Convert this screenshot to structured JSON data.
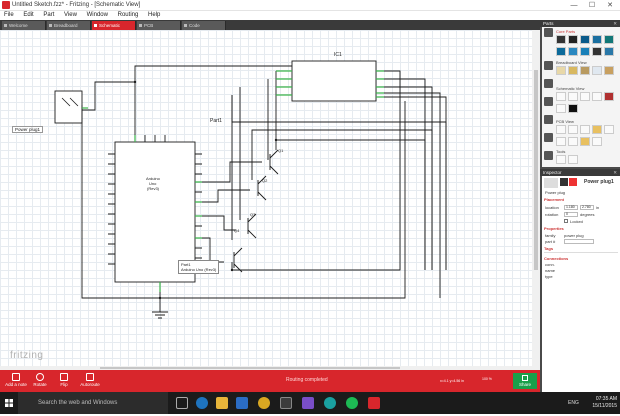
{
  "window": {
    "title": "Untitled Sketch.fzz* - Fritzing - [Schematic View]",
    "min": "—",
    "max": "☐",
    "close": "✕"
  },
  "menu": [
    "File",
    "Edit",
    "Part",
    "View",
    "Window",
    "Routing",
    "Help"
  ],
  "tabs": [
    {
      "label": "Welcome",
      "active": false
    },
    {
      "label": "Breadboard",
      "active": false
    },
    {
      "label": "Schematic",
      "active": true
    },
    {
      "label": "PCB",
      "active": false
    },
    {
      "label": "Code",
      "active": false
    }
  ],
  "canvas": {
    "logo": "fritzing",
    "labels": {
      "ic1": "IC1",
      "part1": "Part1",
      "power_plug": "Power plug1",
      "arduino_name": "Arduino Uno (Rev3)",
      "arduino_line1": "Arduino",
      "arduino_line2": "Uno",
      "arduino_line3": "(Rev3)",
      "q1": "Q1",
      "q2": "Q2",
      "q3": "Q3",
      "q4": "Q4",
      "tooltip_title": "Part1",
      "tooltip_sub": "Arduino Uno (Rev3)"
    }
  },
  "right_panel": {
    "parts_title": "Parts",
    "bins": [
      {
        "label": "Core Parts",
        "icon": "core-icon"
      },
      {
        "label": "Breadboard View",
        "icon": "breadboard-icon"
      },
      {
        "label": "Schematic View",
        "icon": "schematic-icon"
      },
      {
        "label": "PCB View",
        "icon": "pcb-icon"
      },
      {
        "label": "Tools",
        "icon": "tools-icon"
      }
    ],
    "inspector_title": "Inspector",
    "inspector": {
      "name": "Power plug1",
      "subtitle": "Power plug",
      "section_placement": "Placement",
      "location_label": "location",
      "location_x": "1.180",
      "location_y": "2.780",
      "location_unit": "in",
      "rotation_label": "rotation",
      "rotation_value": "0",
      "rotation_unit": "degrees",
      "locked_label": "Locked",
      "section_properties": "Properties",
      "family_label": "family",
      "family_value": "power plug",
      "part_label": "part #",
      "section_tags": "Tags",
      "section_connections": "Connections",
      "conn_label": "conn.",
      "name_label": "name",
      "type_label": "type"
    }
  },
  "bottom_toolbar": {
    "add_note": "Add a note",
    "rotate": "Rotate",
    "flip": "Flip",
    "autoroute": "Autoroute",
    "routing_status": "Routing completed",
    "coords": "x=4.1 y=4.56 in",
    "zoom": "100 %",
    "share": "Share"
  },
  "taskbar": {
    "search_placeholder": "Search the web and Windows",
    "lang": "ENG",
    "time": "07:35 AM",
    "date": "15/11/2015"
  },
  "colors": {
    "brand_red": "#d8262c",
    "wire_dark": "#1c1c1c",
    "pin_green": "#3bb34a",
    "share_green": "#1aa04a"
  }
}
